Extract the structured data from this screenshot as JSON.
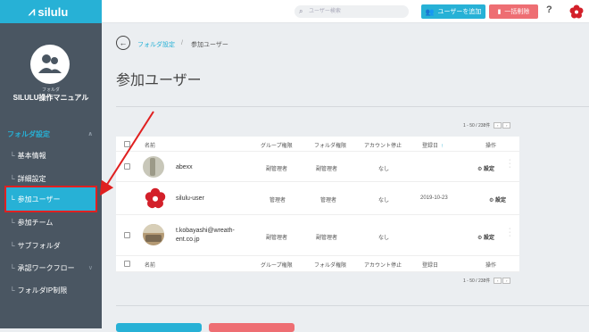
{
  "app": {
    "name": "silulu"
  },
  "sidebar": {
    "folder_ruby": "フォルダ",
    "folder_name": "SILULU操作マニュアル",
    "section_label": "フォルダ設定",
    "items": [
      {
        "label": "基本情報"
      },
      {
        "label": "詳細設定"
      },
      {
        "label": "参加ユーザー"
      },
      {
        "label": "参加チーム"
      },
      {
        "label": "サブフォルダ"
      },
      {
        "label": "承認ワークフロー"
      },
      {
        "label": "フォルダIP制限"
      }
    ]
  },
  "topbar": {
    "search_placeholder": "ユーザー検索",
    "add_user": "ユーザーを追加",
    "bulk_delete": "一括削除",
    "help": "?"
  },
  "breadcrumb": {
    "link": "フォルダ設定",
    "sep": "/",
    "current": "参加ユーザー"
  },
  "page_title": "参加ユーザー",
  "pager": {
    "text": "1 - 50 / 238件"
  },
  "table": {
    "headers": {
      "name": "名前",
      "group": "グループ権限",
      "folder": "フォルダ権限",
      "suspend": "アカウント停止",
      "registered": "登録日",
      "action": "操作"
    },
    "rows": [
      {
        "name": "abexx",
        "group": "副管理者",
        "folder": "副管理者",
        "suspend": "なし",
        "registered": "",
        "action": "設定"
      },
      {
        "name": "silulu-user",
        "group": "管理者",
        "folder": "管理者",
        "suspend": "なし",
        "registered": "2019-10-23",
        "action": "設定"
      },
      {
        "name_line1": "t.kobayashi@wreath-",
        "name_line2": "ent.co.jp",
        "group": "副管理者",
        "folder": "副管理者",
        "suspend": "なし",
        "registered": "",
        "action": "設定"
      }
    ]
  },
  "colors": {
    "accent": "#27b1d6",
    "danger": "#ee6e73",
    "sidebar": "#4a5662",
    "highlight": "#e02020"
  }
}
